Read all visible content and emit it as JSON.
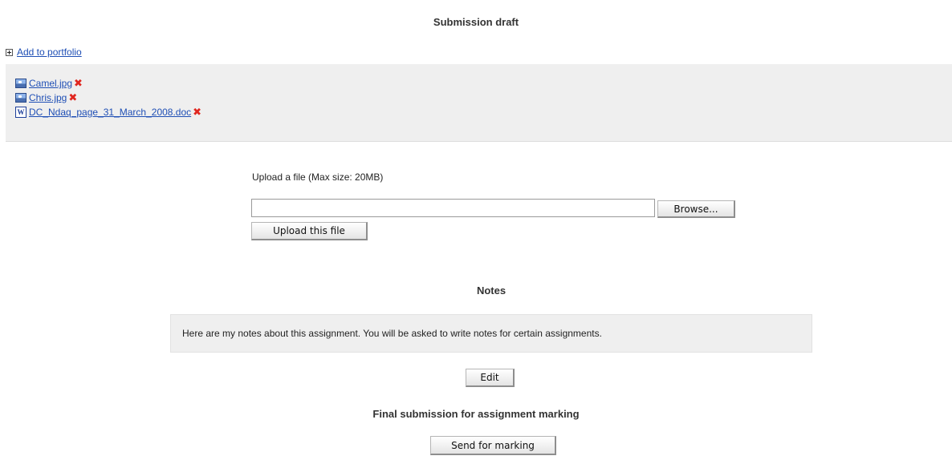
{
  "submission_draft": {
    "title": "Submission draft",
    "portfolio_link": "Add to portfolio",
    "files": [
      {
        "name": "Camel.jpg",
        "icon": "image-file-icon"
      },
      {
        "name": "Chris.jpg",
        "icon": "image-file-icon"
      },
      {
        "name": "DC_Ndaq_page_31_March_2008.doc",
        "icon": "word-document-icon",
        "icon_glyph": "W"
      }
    ],
    "delete_glyph": "✖"
  },
  "upload": {
    "label": "Upload a file (Max size: 20MB)",
    "file_value": "",
    "browse_label": "Browse...",
    "upload_label": "Upload this file"
  },
  "notes": {
    "title": "Notes",
    "text": "Here are my notes about this assignment. You will be asked to write notes for certain assignments.",
    "edit_label": "Edit"
  },
  "final": {
    "title": "Final submission for assignment marking",
    "send_label": "Send for marking"
  },
  "colors": {
    "link": "#1f4fb5",
    "panel": "#efefef",
    "delete": "#e0261f"
  }
}
